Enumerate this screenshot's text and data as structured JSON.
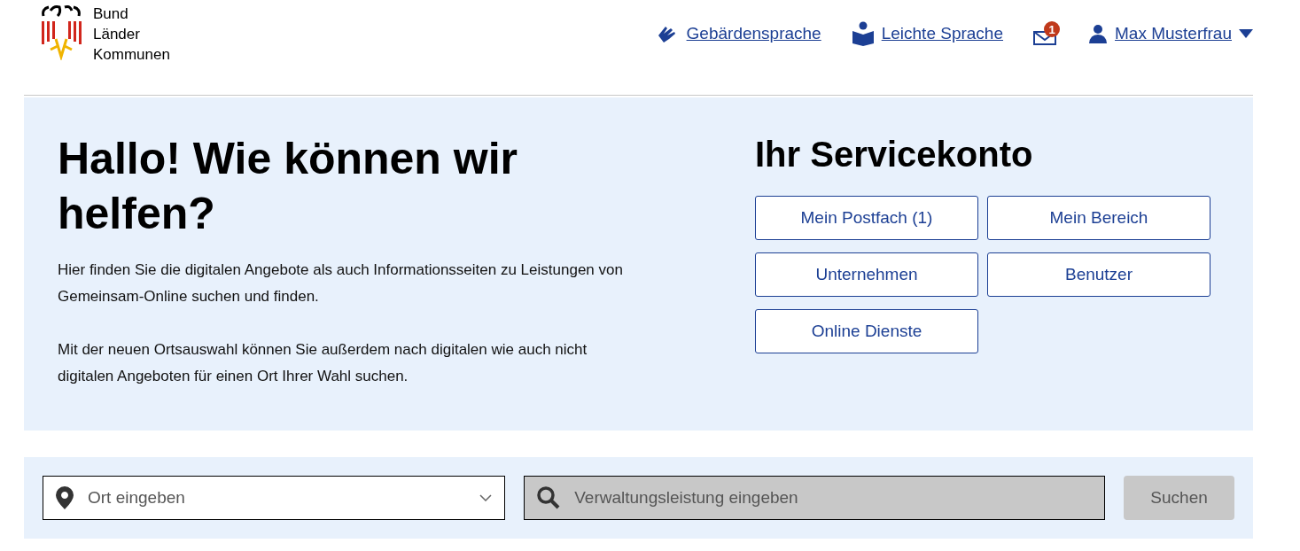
{
  "logo": {
    "lines": [
      "Bund",
      "Länder",
      "Kommunen"
    ]
  },
  "header_links": [
    {
      "kind": "sign",
      "label": "Gebärdensprache"
    },
    {
      "kind": "easy",
      "label": "Leichte Sprache"
    },
    {
      "kind": "mail",
      "badge": "1"
    },
    {
      "kind": "user",
      "label": "Max Musterfrau"
    }
  ],
  "hero": {
    "title": "Hallo! Wie können wir helfen?",
    "paragraphs": [
      "Hier finden Sie die digitalen Angebote als auch Informationsseiten zu Leistungen von Gemeinsam-Online suchen und finden.",
      "Mit der neuen Ortsauswahl können Sie außerdem nach digitalen wie auch nicht digitalen Angeboten für einen Ort Ihrer Wahl suchen."
    ]
  },
  "servicekonto": {
    "title": "Ihr Servicekonto",
    "buttons": [
      "Mein Postfach (1)",
      "Mein Bereich",
      "Unternehmen",
      "Benutzer",
      "Online Dienste"
    ]
  },
  "search": {
    "location_placeholder": "Ort eingeben",
    "query_placeholder": "Verwaltungsleistung eingeben",
    "button": {
      "label": "Suchen",
      "disabled": true
    }
  }
}
